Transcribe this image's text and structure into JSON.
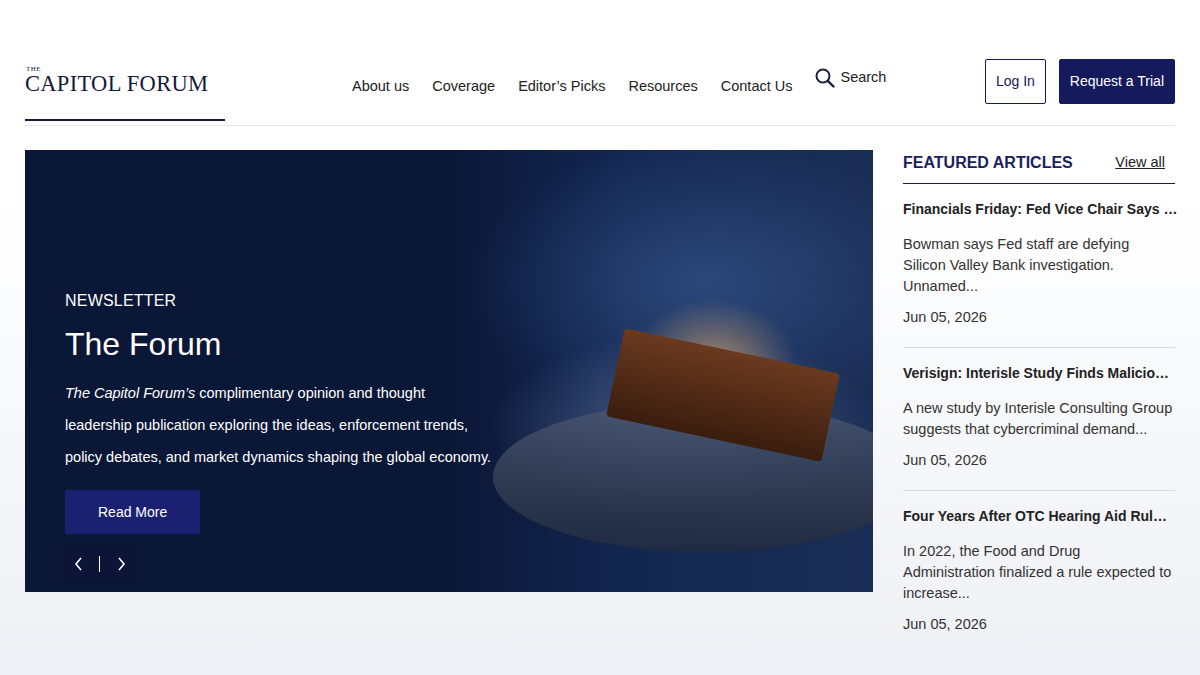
{
  "logo": {
    "small": "THE",
    "name": "CAPITOL FORUM"
  },
  "nav": [
    "About us",
    "Coverage",
    "Editor’s Picks",
    "Resources",
    "Contact Us"
  ],
  "search": {
    "label": "Search"
  },
  "actions": [
    {
      "label": "Log In",
      "kind": "outline"
    },
    {
      "label": "Request a Trial",
      "kind": "filled"
    }
  ],
  "hero": {
    "eyebrow": "NEWSLETTER",
    "title": "The Forum",
    "description_em": "The Capitol Forum’s",
    "description": " complimentary opinion and thought leadership publication exploring the ideas, enforcement trends, policy debates, and market dynamics shaping the global economy.",
    "button": "Read More"
  },
  "featured": {
    "title": "FEATURED ARTICLES",
    "view_all": "View all",
    "articles": [
      {
        "title": "Financials Friday: Fed Vice Chair Says …",
        "excerpt": "Bowman says Fed staff are defying Silicon Valley Bank investigation. Unnamed...",
        "date": "Jun 05, 2026"
      },
      {
        "title": "Verisign: Interisle Study Finds Malicio…",
        "excerpt": "A new study by Interisle Consulting Group suggests that cybercriminal demand...",
        "date": "Jun 05, 2026"
      },
      {
        "title": "Four Years After OTC Hearing Aid Rul…",
        "excerpt": "In 2022, the Food and Drug Administration finalized a rule expected to increase...",
        "date": "Jun 05, 2026"
      }
    ]
  }
}
